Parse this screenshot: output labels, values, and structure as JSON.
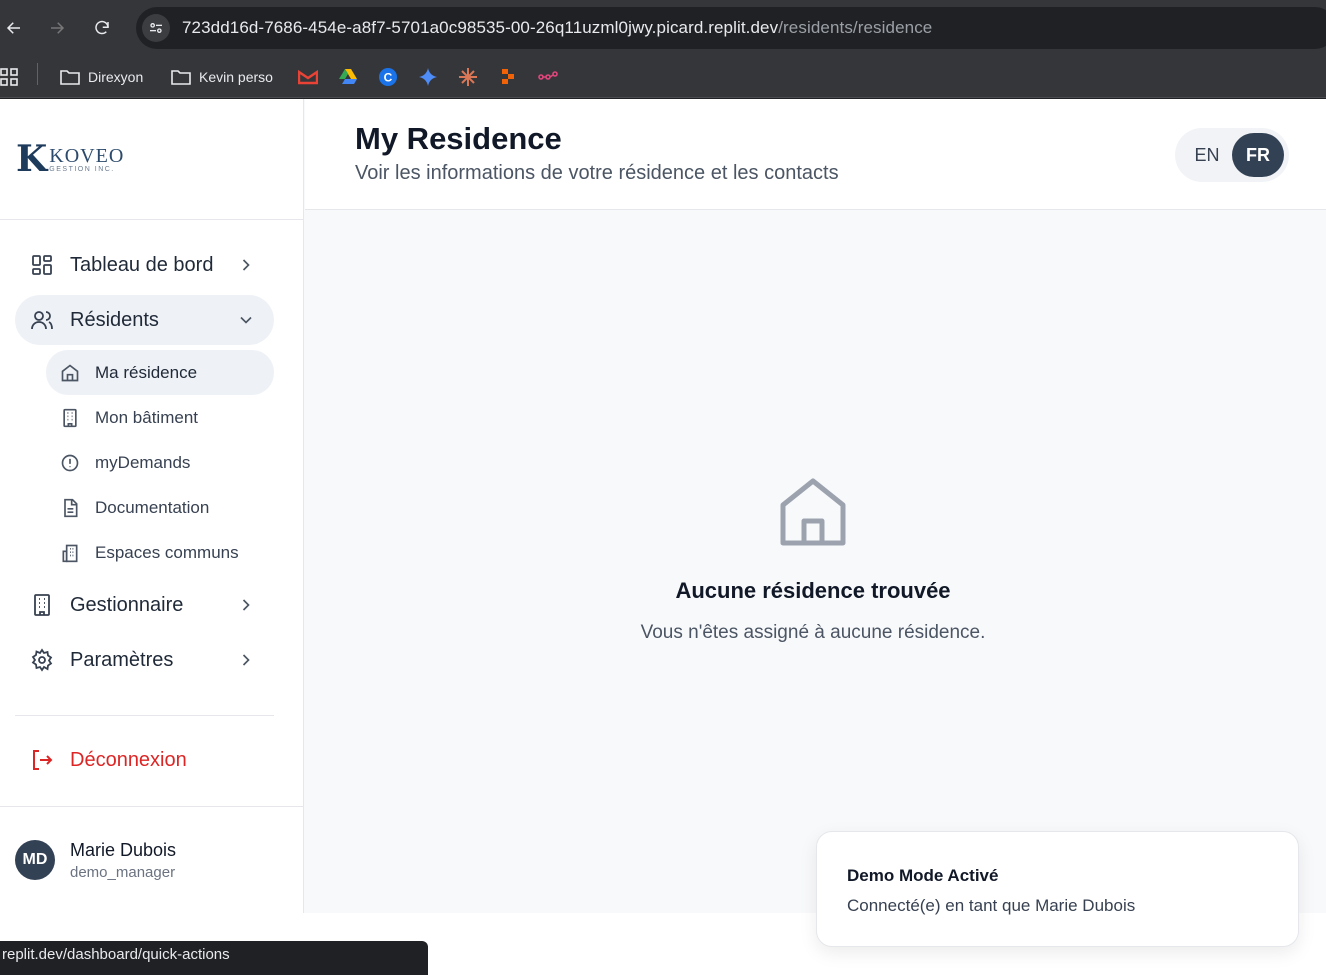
{
  "browser": {
    "url_host": "723dd16d-7686-454e-a8f7-5701a0c98535-00-26q11uzml0jwy.picard.replit.dev",
    "url_path": "/residents/residence",
    "bookmarks": [
      {
        "label": "Direxyon",
        "icon": "folder-icon"
      },
      {
        "label": "Kevin perso",
        "icon": "folder-icon"
      }
    ],
    "status_url": "replit.dev/dashboard/quick-actions"
  },
  "logo": {
    "letter": "K",
    "name": "KOVEO",
    "sub": "GESTION INC."
  },
  "sidebar": {
    "items": [
      {
        "label": "Tableau de bord",
        "icon": "dashboard-icon"
      },
      {
        "label": "Résidents",
        "icon": "users-icon"
      },
      {
        "label": "Gestionnaire",
        "icon": "building-icon"
      },
      {
        "label": "Paramètres",
        "icon": "gear-icon"
      }
    ],
    "sub_items": [
      {
        "label": "Ma résidence",
        "icon": "home-icon"
      },
      {
        "label": "Mon bâtiment",
        "icon": "building-icon"
      },
      {
        "label": "myDemands",
        "icon": "alert-circle-icon"
      },
      {
        "label": "Documentation",
        "icon": "document-icon"
      },
      {
        "label": "Espaces communs",
        "icon": "common-spaces-icon"
      }
    ],
    "logout_label": "Déconnexion"
  },
  "user": {
    "initials": "MD",
    "name": "Marie Dubois",
    "role": "demo_manager"
  },
  "header": {
    "title": "My Residence",
    "subtitle": "Voir les informations de votre résidence et les contacts",
    "lang_en": "EN",
    "lang_fr": "FR"
  },
  "empty_state": {
    "title": "Aucune résidence trouvée",
    "message": "Vous n'êtes assigné à aucune résidence."
  },
  "toast": {
    "title": "Demo Mode Activé",
    "message": "Connecté(e) en tant que Marie Dubois"
  },
  "colors": {
    "accent": "#334155",
    "danger": "#dc2626",
    "active_bg": "#eef1f6"
  }
}
